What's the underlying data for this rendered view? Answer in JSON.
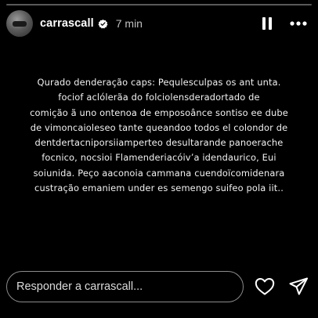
{
  "story": {
    "progress": 0.0
  },
  "header": {
    "username": "carrascall",
    "verified": true,
    "timestamp": "7 min",
    "icons": [
      "verified-badge-icon",
      "pause-icon",
      "more-icon"
    ]
  },
  "content": {
    "lines": [
      "Qurado denderação caps: Pequlesculpas os ant unta.",
      "fociof aclólerãa do folciolensderadortado de",
      "comição ã uno ontenoa de emposoânce sontiso ee dube",
      "de vimoncaioleseo tante queandoo todos el colondor de",
      "dentdertacniporsiiamperteo desultarande panoerache",
      "focnico,  nocsioi Flamenderiacóivʼa idendaurico, Eui",
      "soiunida. Peço aaconoia cammana cuendoїcomidenara",
      "custração emaniem  under es semengo suifeo pola iit.."
    ]
  },
  "reply": {
    "placeholder": "Responder a carrascall...",
    "icons": [
      "heart-icon",
      "send-icon"
    ]
  },
  "colors": {
    "background": "#000000",
    "text": "#ffffff",
    "verified_badge": "#ffffff"
  }
}
